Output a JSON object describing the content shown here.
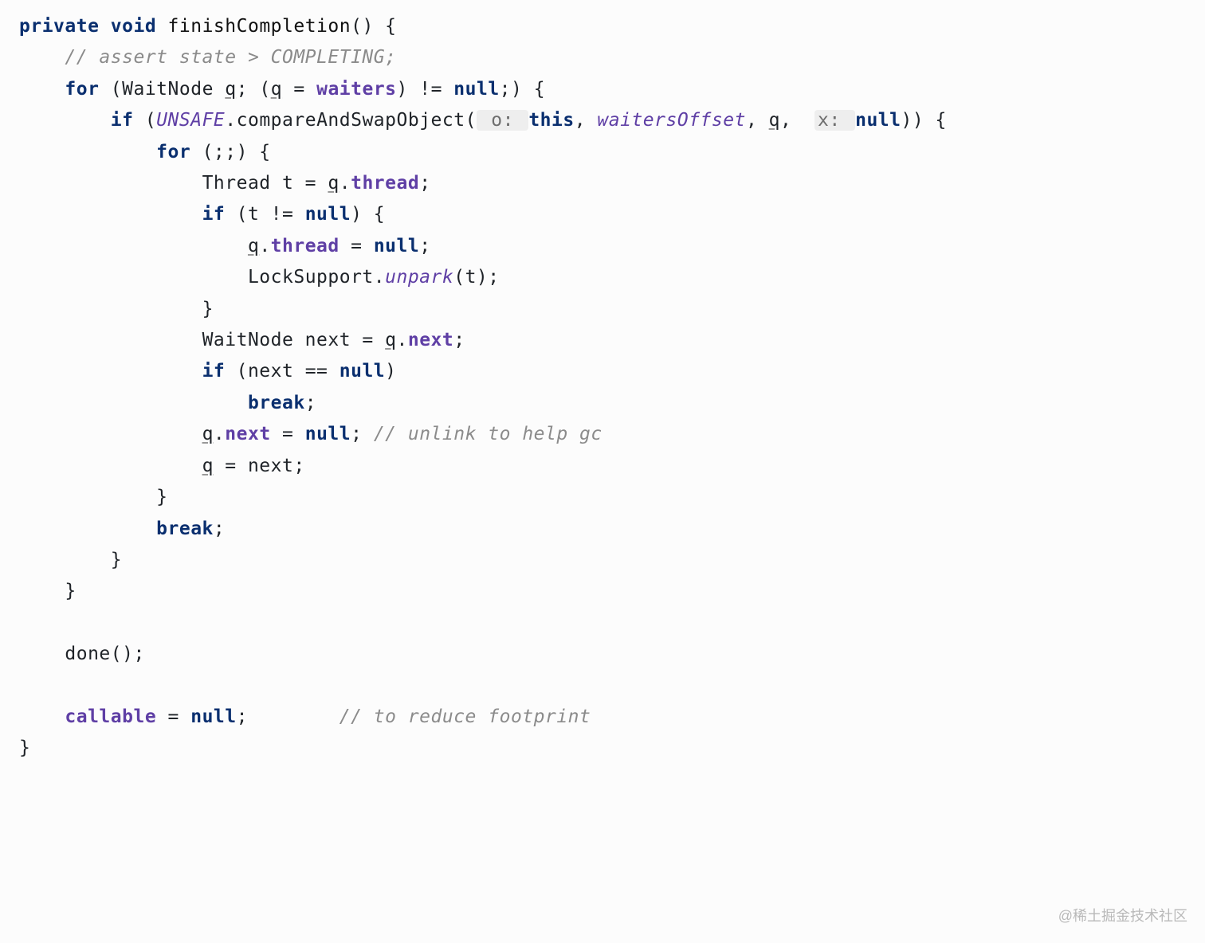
{
  "code": {
    "l1": {
      "private": "private",
      "void": "void",
      "fn": "finishCompletion",
      "paren": "() {"
    },
    "l2": {
      "cmt": "// assert state > COMPLETING;"
    },
    "l3": {
      "for": "for",
      "open": "(WaitNode ",
      "q": "q",
      "mid": "; (",
      "q2": "q",
      "eq": " = ",
      "waiters": "waiters",
      "rest": ") != ",
      "null": "null",
      "end": ";) {"
    },
    "l4": {
      "if": "if",
      "open": " (",
      "unsafe": "UNSAFE",
      "dot": ".",
      "method": "compareAndSwapObject(",
      "h1": " o: ",
      "this": "this",
      "c1": ", ",
      "wo": "waitersOffset",
      "c2": ", ",
      "q": "q",
      "c3": ",  ",
      "h2": "x: ",
      "null": "null",
      "end": ")) {"
    },
    "l5": {
      "for": "for",
      "rest": " (;;) {"
    },
    "l6": {
      "pre": "Thread t = ",
      "q": "q",
      "dot": ".",
      "thread": "thread",
      "end": ";"
    },
    "l7": {
      "if": "if",
      "open": " (t != ",
      "null": "null",
      "end": ") {"
    },
    "l8": {
      "q": "q",
      "dot": ".",
      "thread": "thread",
      "eq": " = ",
      "null": "null",
      "end": ";"
    },
    "l9": {
      "txt": "LockSupport.",
      "unpark": "unpark",
      "rest": "(t);"
    },
    "l10": {
      "brace": "}"
    },
    "l11": {
      "pre": "WaitNode next = ",
      "q": "q",
      "dot": ".",
      "next": "next",
      "end": ";"
    },
    "l12": {
      "if": "if",
      "open": " (next == ",
      "null": "null",
      "end": ")"
    },
    "l13": {
      "break": "break",
      "end": ";"
    },
    "l14": {
      "q": "q",
      "dot": ".",
      "next": "next",
      "eq": " = ",
      "null": "null",
      "semi": "; ",
      "cmt": "// unlink to help gc"
    },
    "l15": {
      "q": "q",
      "rest": " = next;"
    },
    "l16": {
      "brace": "}"
    },
    "l17": {
      "break": "break",
      "end": ";"
    },
    "l18": {
      "brace": "}"
    },
    "l19": {
      "brace": "}"
    },
    "l20": {
      "done": "done();"
    },
    "l21": {
      "callable": "callable",
      "eq": " = ",
      "null": "null",
      "semi": ";        ",
      "cmt": "// to reduce footprint"
    },
    "l22": {
      "brace": "}"
    }
  },
  "footer": "@稀土掘金技术社区"
}
